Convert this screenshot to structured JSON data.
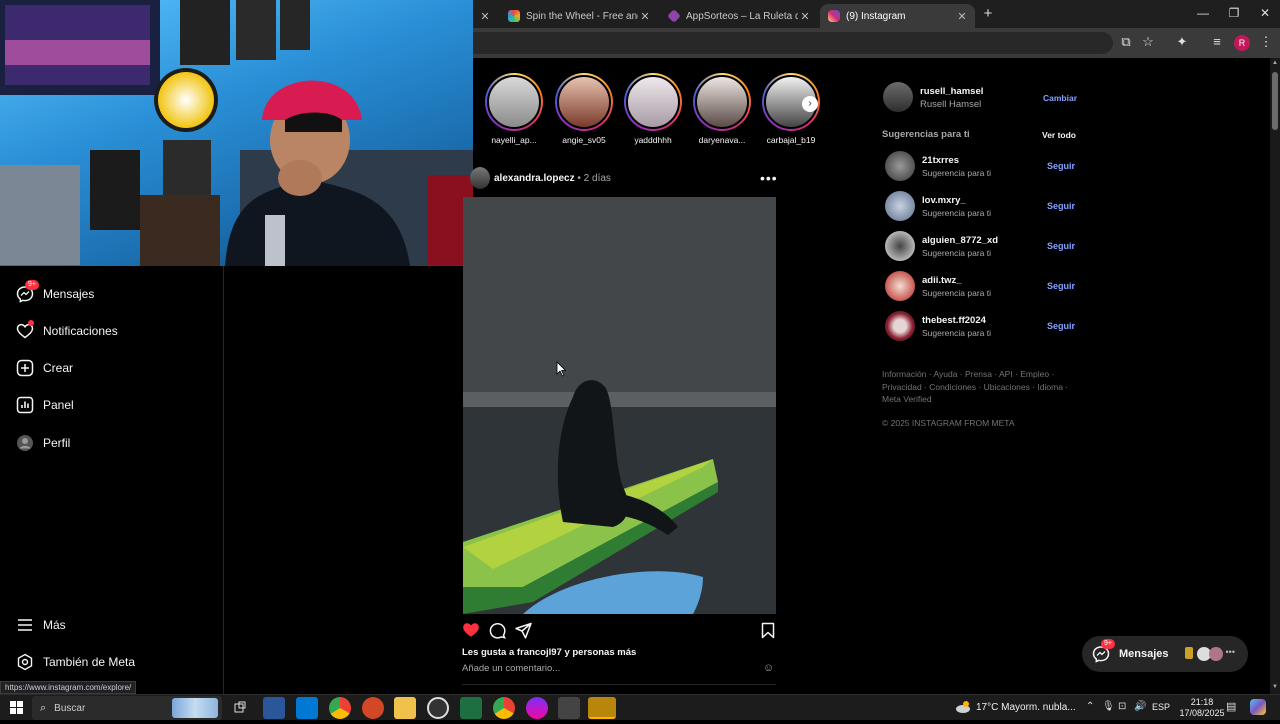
{
  "browser": {
    "tabs": [
      {
        "label": "Spin the Wheel - Free and easy",
        "favicon_color": "#f5a623"
      },
      {
        "label": "AppSorteos – La Ruleta de la Suerte",
        "favicon_color": "#8e44ad"
      },
      {
        "label": "(9) Instagram",
        "favicon_color": "#e1306c",
        "active": true
      }
    ],
    "new_tab_symbol": "+",
    "profile_initial": "R",
    "status_url": "https://www.instagram.com/explore/"
  },
  "nav": {
    "items": [
      {
        "label": "Mensajes",
        "icon": "messenger-icon",
        "badge": "9+"
      },
      {
        "label": "Notificaciones",
        "icon": "heart-icon"
      },
      {
        "label": "Crear",
        "icon": "plus-square-icon"
      },
      {
        "label": "Panel",
        "icon": "chart-icon"
      },
      {
        "label": "Perfil",
        "icon": "avatar-icon"
      }
    ],
    "more_label": "Más",
    "meta_label": "También de Meta"
  },
  "stories": [
    {
      "name": "nayelli_ap..."
    },
    {
      "name": "angie_sv05"
    },
    {
      "name": "yadddhhh"
    },
    {
      "name": "daryenava..."
    },
    {
      "name": "carbajal_b19"
    }
  ],
  "post": {
    "author": "alexandra.lopecz",
    "separator": "•",
    "time": "2 días",
    "likes_prefix": "Les gusta a ",
    "likes_user": "francojl97",
    "likes_suffix": " y personas más",
    "comment_placeholder": "Añade un comentario...",
    "liked": true,
    "like_color": "#ff3040"
  },
  "sidebar": {
    "account": {
      "username": "rusell_hamsel",
      "fullname": "Rusell Hamsel",
      "switch_label": "Cambiar"
    },
    "suggestions_title": "Sugerencias para ti",
    "see_all": "Ver todo",
    "suggestions": [
      {
        "username": "21txrres",
        "sub": "Sugerencia para ti",
        "action": "Seguir"
      },
      {
        "username": "lov.mxry_",
        "sub": "Sugerencia para ti",
        "action": "Seguir"
      },
      {
        "username": "alguien_8772_xd",
        "sub": "Sugerencia para ti",
        "action": "Seguir"
      },
      {
        "username": "adii.twz_",
        "sub": "Sugerencia para ti",
        "action": "Seguir"
      },
      {
        "username": "thebest.ff2024",
        "sub": "Sugerencia para ti",
        "action": "Seguir"
      }
    ],
    "footer_line1": "Información · Ayuda · Prensa · API · Empleo ·",
    "footer_line2": "Privacidad · Condiciones · Ubicaciones · Idioma ·",
    "footer_line3": "Meta Verified",
    "copyright": "© 2025 INSTAGRAM FROM META"
  },
  "messages_button": {
    "label": "Mensajes",
    "badge": "9+"
  },
  "taskbar": {
    "search_placeholder": "Buscar",
    "weather_temp": "17°C",
    "weather_desc": "Mayorm. nubla...",
    "language": "ESP",
    "time": "21:18",
    "date": "17/08/2025"
  }
}
